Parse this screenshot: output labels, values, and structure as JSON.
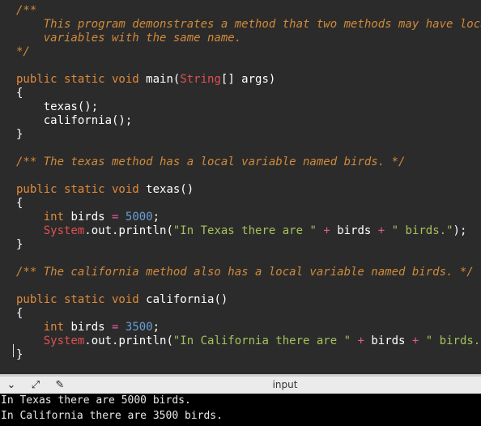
{
  "editor": {
    "lines": [
      [
        {
          "t": "/**",
          "c": "comment"
        }
      ],
      [
        {
          "t": "    This program demonstrates a method that two methods may have local",
          "c": "comment"
        }
      ],
      [
        {
          "t": "    variables with the same name.",
          "c": "comment"
        }
      ],
      [
        {
          "t": "*/",
          "c": "comment"
        }
      ],
      [],
      [
        {
          "t": "public static void ",
          "c": "kw"
        },
        {
          "t": "main(",
          "c": "text"
        },
        {
          "t": "String",
          "c": "type"
        },
        {
          "t": "[] args)",
          "c": "text"
        }
      ],
      [
        {
          "t": "{",
          "c": "text"
        }
      ],
      [
        {
          "t": "    texas();",
          "c": "text"
        }
      ],
      [
        {
          "t": "    california();",
          "c": "text"
        }
      ],
      [
        {
          "t": "}",
          "c": "text"
        }
      ],
      [],
      [
        {
          "t": "/** The texas method has a local variable named birds. */",
          "c": "comment"
        }
      ],
      [],
      [
        {
          "t": "public static void ",
          "c": "kw"
        },
        {
          "t": "texas()",
          "c": "text"
        }
      ],
      [
        {
          "t": "{",
          "c": "text"
        }
      ],
      [
        {
          "t": "    ",
          "c": "text"
        },
        {
          "t": "int",
          "c": "kw"
        },
        {
          "t": " birds ",
          "c": "text"
        },
        {
          "t": "=",
          "c": "op"
        },
        {
          "t": " ",
          "c": "text"
        },
        {
          "t": "5000",
          "c": "num"
        },
        {
          "t": ";",
          "c": "text"
        }
      ],
      [
        {
          "t": "    ",
          "c": "text"
        },
        {
          "t": "System",
          "c": "type"
        },
        {
          "t": ".out.println(",
          "c": "text"
        },
        {
          "t": "\"In Texas there are \"",
          "c": "str"
        },
        {
          "t": " ",
          "c": "text"
        },
        {
          "t": "+",
          "c": "op"
        },
        {
          "t": " birds ",
          "c": "text"
        },
        {
          "t": "+",
          "c": "op"
        },
        {
          "t": " ",
          "c": "text"
        },
        {
          "t": "\" birds.\"",
          "c": "str"
        },
        {
          "t": ");",
          "c": "text"
        }
      ],
      [
        {
          "t": "}",
          "c": "text"
        }
      ],
      [],
      [
        {
          "t": "/** The california method also has a local variable named birds. */",
          "c": "comment"
        }
      ],
      [],
      [
        {
          "t": "public static void ",
          "c": "kw"
        },
        {
          "t": "california()",
          "c": "text"
        }
      ],
      [
        {
          "t": "{",
          "c": "text"
        }
      ],
      [
        {
          "t": "    ",
          "c": "text"
        },
        {
          "t": "int",
          "c": "kw"
        },
        {
          "t": " birds ",
          "c": "text"
        },
        {
          "t": "=",
          "c": "op"
        },
        {
          "t": " ",
          "c": "text"
        },
        {
          "t": "3500",
          "c": "num"
        },
        {
          "t": ";",
          "c": "text"
        }
      ],
      [
        {
          "t": "    ",
          "c": "text"
        },
        {
          "t": "System",
          "c": "type"
        },
        {
          "t": ".out.println(",
          "c": "text"
        },
        {
          "t": "\"In California there are \"",
          "c": "str"
        },
        {
          "t": " ",
          "c": "text"
        },
        {
          "t": "+",
          "c": "op"
        },
        {
          "t": " birds ",
          "c": "text"
        },
        {
          "t": "+",
          "c": "op"
        },
        {
          "t": " ",
          "c": "text"
        },
        {
          "t": "\" birds.\"",
          "c": "str"
        },
        {
          "t": ");",
          "c": "text"
        }
      ],
      [
        {
          "t": "}",
          "c": "text"
        }
      ]
    ]
  },
  "io_panel": {
    "title": "input",
    "icons": [
      "chevron-down-icon",
      "expand-icon",
      "clear-icon"
    ]
  },
  "console": {
    "lines": [
      "In Texas there are 5000 birds.",
      "In California there are 3500 birds."
    ]
  },
  "colors": {
    "editor_bg": "#2b2b2b",
    "comment": "#d08a3a",
    "keyword": "#e08a3a",
    "type": "#e05050",
    "string": "#a5c25c",
    "number": "#6a9fd6",
    "operator": "#e05a9a",
    "console_bg": "#000000"
  }
}
